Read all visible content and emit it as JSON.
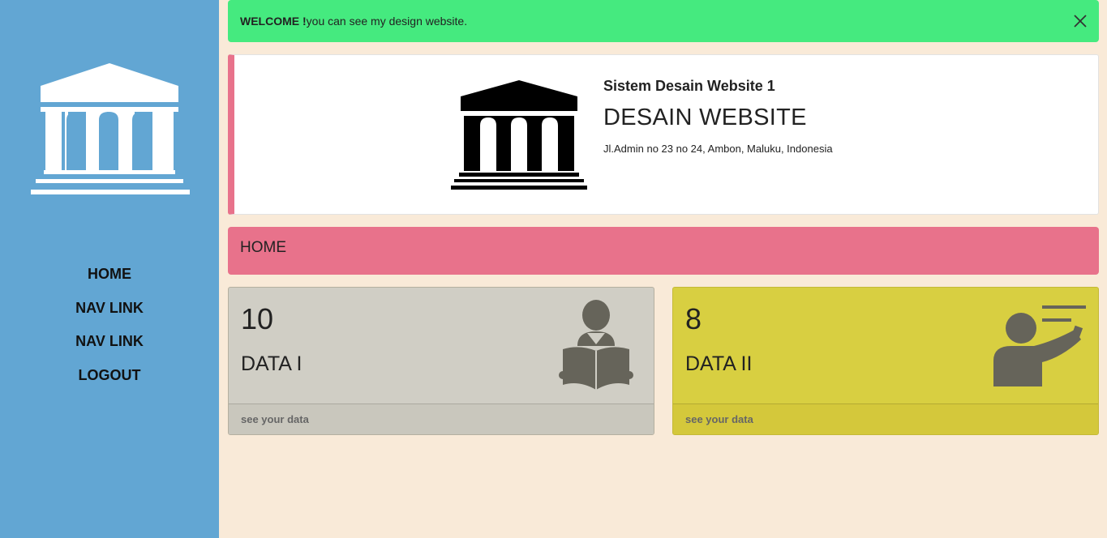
{
  "sidebar": {
    "logo_icon": "bank-icon",
    "nav": [
      {
        "label": "HOME"
      },
      {
        "label": "NAV LINK"
      },
      {
        "label": "NAV LINK"
      },
      {
        "label": "LOGOUT"
      }
    ]
  },
  "alert": {
    "strong": "WELCOME !",
    "text": "you can see my design website.",
    "close_icon": "close-icon"
  },
  "header": {
    "logo_icon": "bank-icon",
    "subtitle": "Sistem Desain Website 1",
    "title": "DESAIN WEBSITE",
    "address": "Jl.Admin no 23 no 24, Ambon, Maluku, Indonesia",
    "accent_color": "#e8728b"
  },
  "breadcrumb": {
    "label": "HOME"
  },
  "cards": [
    {
      "value": "10",
      "label": "DATA I",
      "footer": "see your data",
      "icon": "reader-icon",
      "color": "#d0cec5"
    },
    {
      "value": "8",
      "label": "DATA II",
      "footer": "see your data",
      "icon": "teacher-icon",
      "color": "#d8cf41"
    }
  ],
  "colors": {
    "sidebar": "#62a6d3",
    "background": "#f9ead8",
    "alert": "#45ea7f"
  }
}
